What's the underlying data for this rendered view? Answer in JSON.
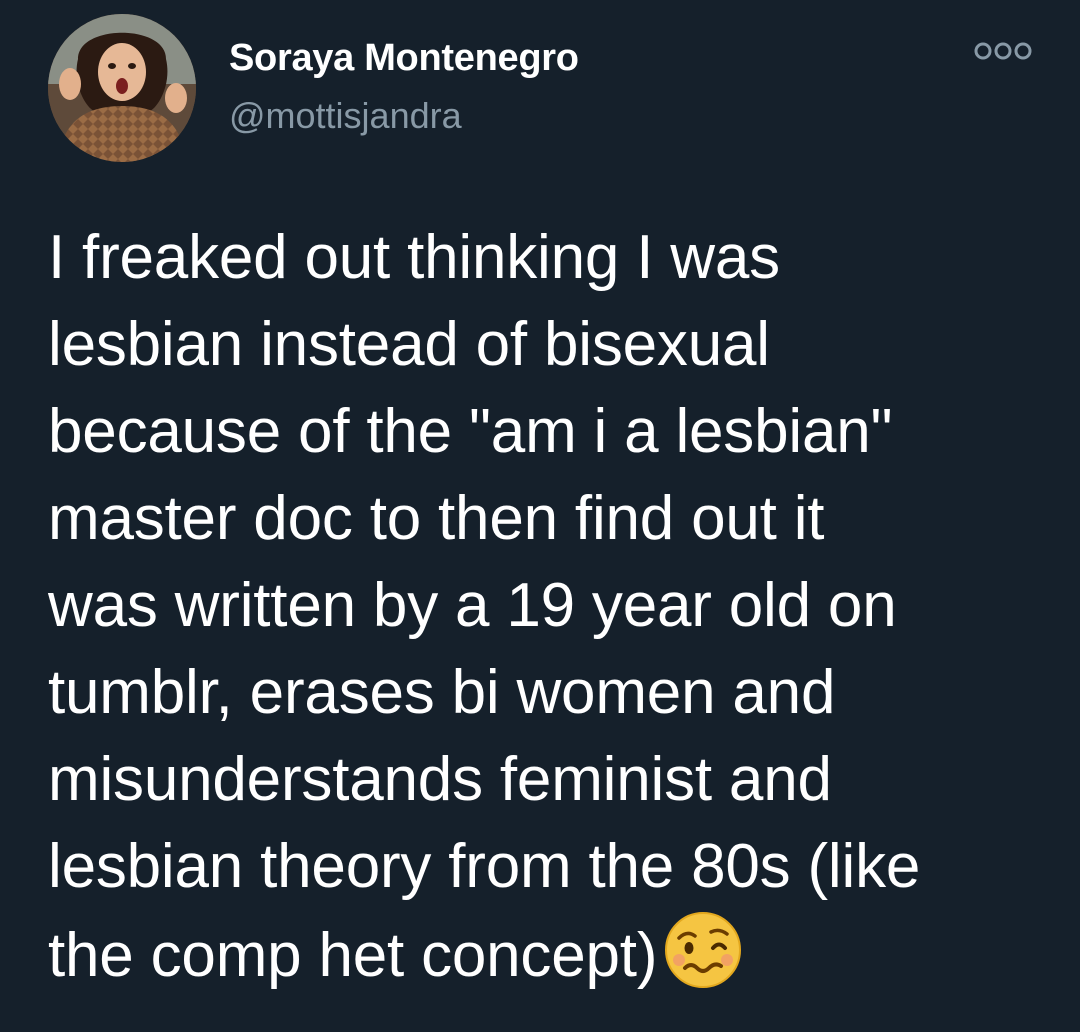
{
  "tweet": {
    "display_name": "Soraya Montenegro",
    "handle": "@mottisjandra",
    "text": "I freaked out thinking I was\nlesbian instead of bisexual\nbecause of the \"am i a lesbian\"\nmaster doc to then find out it\nwas written by a 19 year old on\ntumblr, erases bi women and\nmisunderstands feminist and\nlesbian theory from the 80s (like\nthe comp het concept)",
    "emoji_icon": "woozy-face-icon",
    "more_icon": "more-options-icon"
  },
  "colors": {
    "background": "#15202b",
    "primary_text": "#ffffff",
    "secondary_text": "#8899a6"
  }
}
